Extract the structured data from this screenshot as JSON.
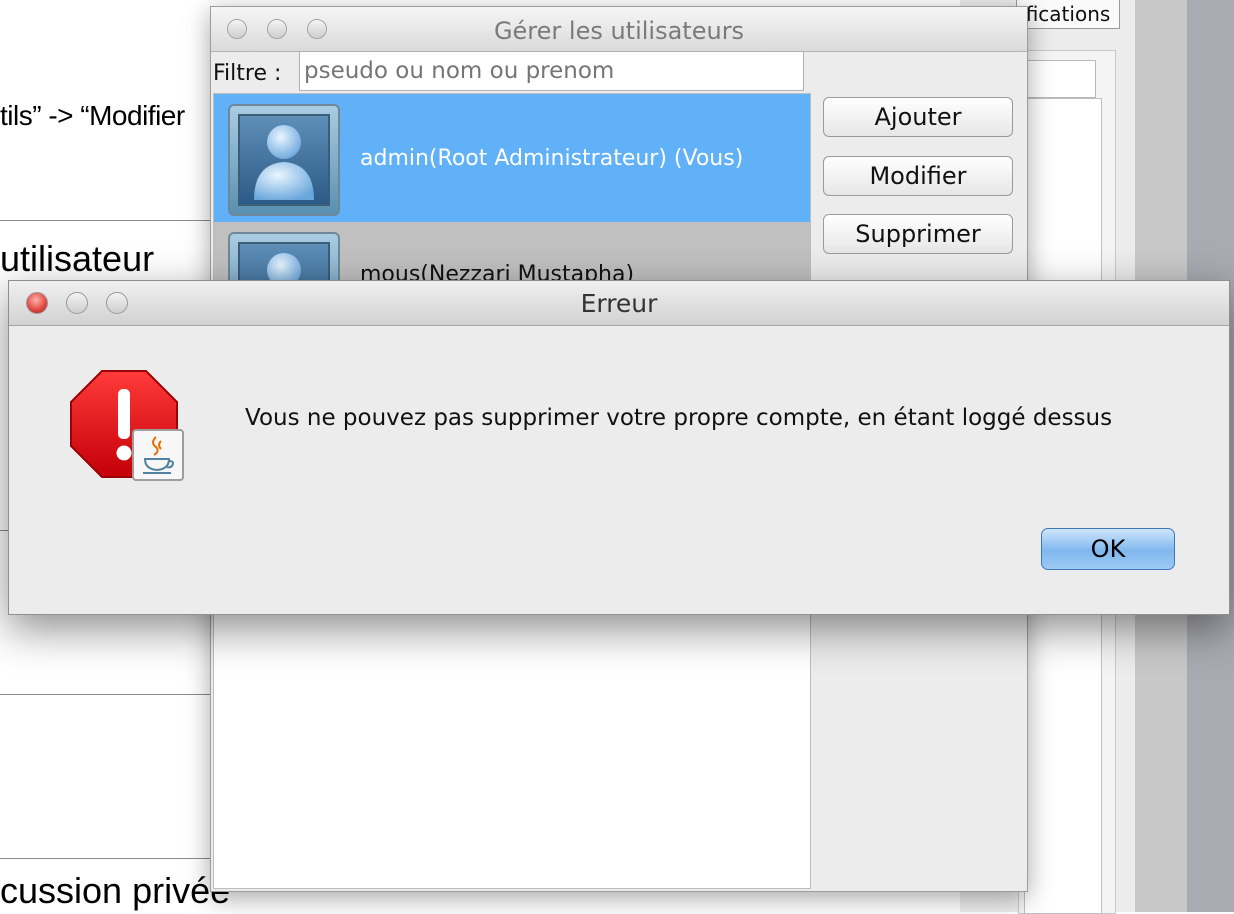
{
  "background_doc": {
    "line1": "tils” -> “Modifier",
    "line2": "utilisateur",
    "line3": "cussion privée"
  },
  "back_window": {
    "button_label": "fications"
  },
  "users_window": {
    "title": "Gérer les utilisateurs",
    "filter_label": "Filtre :",
    "filter_placeholder": "pseudo ou nom ou prenom",
    "users": [
      {
        "label": "admin(Root Administrateur) (Vous)"
      },
      {
        "label": "mous(Nezzari Mustapha)"
      }
    ],
    "buttons": {
      "add": "Ajouter",
      "modify": "Modifier",
      "delete": "Supprimer"
    }
  },
  "error_dialog": {
    "title": "Erreur",
    "message": "Vous ne pouvez pas supprimer votre propre compte, en étant loggé dessus",
    "ok_label": "OK"
  },
  "colors": {
    "selection": "#61b1f8",
    "close_red": "#e0443e",
    "stop_red": "#e8000d",
    "ok_blue": "#7fb7ee"
  },
  "icons": {
    "error_icon": "stop-sign-exclamation-icon",
    "badge_icon": "java-coffee-cup-icon",
    "avatar_icon": "user-avatar-icon"
  }
}
